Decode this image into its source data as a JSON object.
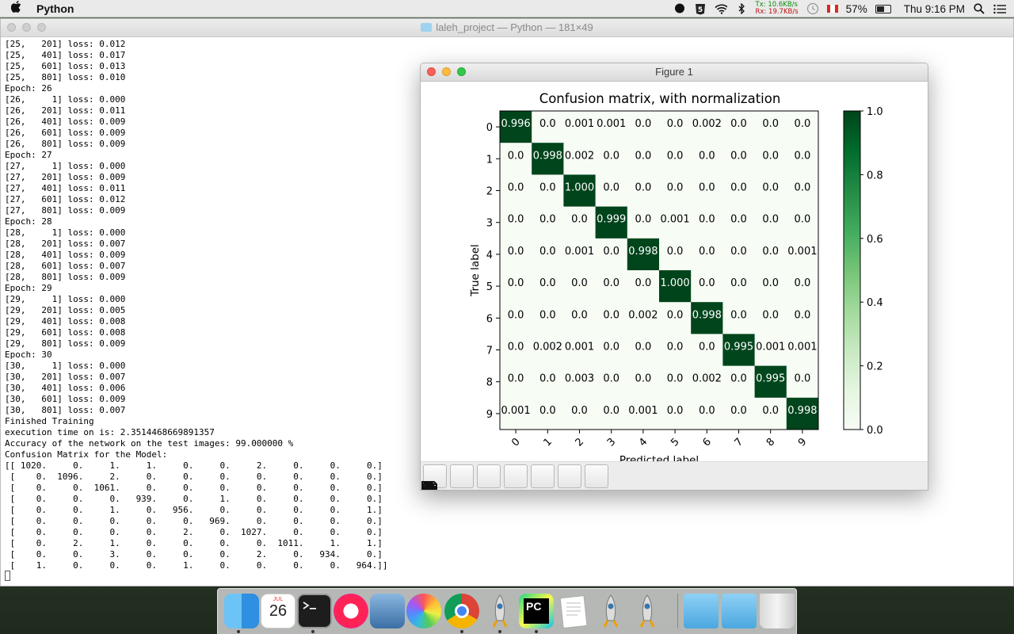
{
  "menubar": {
    "app_name": "Python",
    "net_tx": "Tx: 10.6KB/s",
    "net_rx": "Rx: 19.7KB/s",
    "battery": "57%",
    "battery_level": 0.57,
    "clock": "Thu 9:16 PM"
  },
  "terminal": {
    "title": "laleh_project — Python — 181×49",
    "lines": [
      "[25,   201] loss: 0.012",
      "[25,   401] loss: 0.017",
      "[25,   601] loss: 0.013",
      "[25,   801] loss: 0.010",
      "Epoch: 26",
      "[26,     1] loss: 0.000",
      "[26,   201] loss: 0.011",
      "[26,   401] loss: 0.009",
      "[26,   601] loss: 0.009",
      "[26,   801] loss: 0.009",
      "Epoch: 27",
      "[27,     1] loss: 0.000",
      "[27,   201] loss: 0.009",
      "[27,   401] loss: 0.011",
      "[27,   601] loss: 0.012",
      "[27,   801] loss: 0.009",
      "Epoch: 28",
      "[28,     1] loss: 0.000",
      "[28,   201] loss: 0.007",
      "[28,   401] loss: 0.009",
      "[28,   601] loss: 0.007",
      "[28,   801] loss: 0.009",
      "Epoch: 29",
      "[29,     1] loss: 0.000",
      "[29,   201] loss: 0.005",
      "[29,   401] loss: 0.008",
      "[29,   601] loss: 0.008",
      "[29,   801] loss: 0.009",
      "Epoch: 30",
      "[30,     1] loss: 0.000",
      "[30,   201] loss: 0.007",
      "[30,   401] loss: 0.006",
      "[30,   601] loss: 0.009",
      "[30,   801] loss: 0.007",
      "Finished Training",
      "execution time on is: 2.3514468669891357",
      "Accuracy of the network on the test images: 99.000000 %",
      "Confusion Matrix for the Model:",
      "[[ 1020.     0.     1.     1.     0.     0.     2.     0.     0.     0.]",
      " [    0.  1096.     2.     0.     0.     0.     0.     0.     0.     0.]",
      " [    0.     0.  1061.     0.     0.     0.     0.     0.     0.     0.]",
      " [    0.     0.     0.   939.     0.     1.     0.     0.     0.     0.]",
      " [    0.     0.     1.     0.   956.     0.     0.     0.     0.     1.]",
      " [    0.     0.     0.     0.     0.   969.     0.     0.     0.     0.]",
      " [    0.     0.     0.     0.     2.     0.  1027.     0.     0.     0.]",
      " [    0.     2.     1.     0.     0.     0.     0.  1011.     1.     1.]",
      " [    0.     0.     3.     0.     0.     0.     2.     0.   934.     0.]",
      " [    1.     0.     0.     0.     1.     0.     0.     0.     0.   964.]]"
    ]
  },
  "figure": {
    "window_title": "Figure 1",
    "toolbar": [
      "home-icon",
      "back-icon",
      "forward-icon",
      "pan-icon",
      "zoom-icon",
      "configure-icon",
      "save-icon"
    ]
  },
  "chart_data": {
    "type": "heatmap",
    "title": "Confusion matrix, with normalization",
    "xlabel": "Predicted label",
    "ylabel": "True label",
    "x_ticks": [
      "0",
      "1",
      "2",
      "3",
      "4",
      "5",
      "6",
      "7",
      "8",
      "9"
    ],
    "y_ticks": [
      "0",
      "1",
      "2",
      "3",
      "4",
      "5",
      "6",
      "7",
      "8",
      "9"
    ],
    "cell_labels": [
      [
        "0.996",
        "0.0",
        "0.001",
        "0.001",
        "0.0",
        "0.0",
        "0.002",
        "0.0",
        "0.0",
        "0.0"
      ],
      [
        "0.0",
        "0.998",
        "0.002",
        "0.0",
        "0.0",
        "0.0",
        "0.0",
        "0.0",
        "0.0",
        "0.0"
      ],
      [
        "0.0",
        "0.0",
        "1.000",
        "0.0",
        "0.0",
        "0.0",
        "0.0",
        "0.0",
        "0.0",
        "0.0"
      ],
      [
        "0.0",
        "0.0",
        "0.0",
        "0.999",
        "0.0",
        "0.001",
        "0.0",
        "0.0",
        "0.0",
        "0.0"
      ],
      [
        "0.0",
        "0.0",
        "0.001",
        "0.0",
        "0.998",
        "0.0",
        "0.0",
        "0.0",
        "0.0",
        "0.001"
      ],
      [
        "0.0",
        "0.0",
        "0.0",
        "0.0",
        "0.0",
        "1.000",
        "0.0",
        "0.0",
        "0.0",
        "0.0"
      ],
      [
        "0.0",
        "0.0",
        "0.0",
        "0.0",
        "0.002",
        "0.0",
        "0.998",
        "0.0",
        "0.0",
        "0.0"
      ],
      [
        "0.0",
        "0.002",
        "0.001",
        "0.0",
        "0.0",
        "0.0",
        "0.0",
        "0.995",
        "0.001",
        "0.001"
      ],
      [
        "0.0",
        "0.0",
        "0.003",
        "0.0",
        "0.0",
        "0.0",
        "0.002",
        "0.0",
        "0.995",
        "0.0"
      ],
      [
        "0.001",
        "0.0",
        "0.0",
        "0.0",
        "0.001",
        "0.0",
        "0.0",
        "0.0",
        "0.0",
        "0.998"
      ]
    ],
    "values": [
      [
        0.996,
        0,
        0.001,
        0.001,
        0,
        0,
        0.002,
        0,
        0,
        0
      ],
      [
        0,
        0.998,
        0.002,
        0,
        0,
        0,
        0,
        0,
        0,
        0
      ],
      [
        0,
        0,
        1.0,
        0,
        0,
        0,
        0,
        0,
        0,
        0
      ],
      [
        0,
        0,
        0,
        0.999,
        0,
        0.001,
        0,
        0,
        0,
        0
      ],
      [
        0,
        0,
        0.001,
        0,
        0.998,
        0,
        0,
        0,
        0,
        0.001
      ],
      [
        0,
        0,
        0,
        0,
        0,
        1.0,
        0,
        0,
        0,
        0
      ],
      [
        0,
        0,
        0,
        0,
        0.002,
        0,
        0.998,
        0,
        0,
        0
      ],
      [
        0,
        0.002,
        0.001,
        0,
        0,
        0,
        0,
        0.995,
        0.001,
        0.001
      ],
      [
        0,
        0,
        0.003,
        0,
        0,
        0,
        0.002,
        0,
        0.995,
        0
      ],
      [
        0.001,
        0,
        0,
        0,
        0.001,
        0,
        0,
        0,
        0,
        0.998
      ]
    ],
    "colormap": "Greens",
    "color_low": "#f7fcf5",
    "color_high": "#00441b",
    "colorbar_ticks": [
      "0.0",
      "0.2",
      "0.4",
      "0.6",
      "0.8",
      "1.0"
    ],
    "colorbar_range": [
      0,
      1
    ],
    "grid": false
  },
  "dock": {
    "calendar_month": "JUL",
    "calendar_day": "26",
    "apps": [
      "finder-icon",
      "calendar-icon",
      "terminal-icon",
      "itunes-icon",
      "preview-icon",
      "photos-icon",
      "chrome-icon",
      "python-launcher-icon",
      "pycharm-icon",
      "textedit-icon",
      "python-launcher-icon",
      "python-launcher-icon",
      "applications-folder-icon",
      "downloads-folder-icon",
      "trash-icon"
    ],
    "pycharm_label": "PC"
  }
}
